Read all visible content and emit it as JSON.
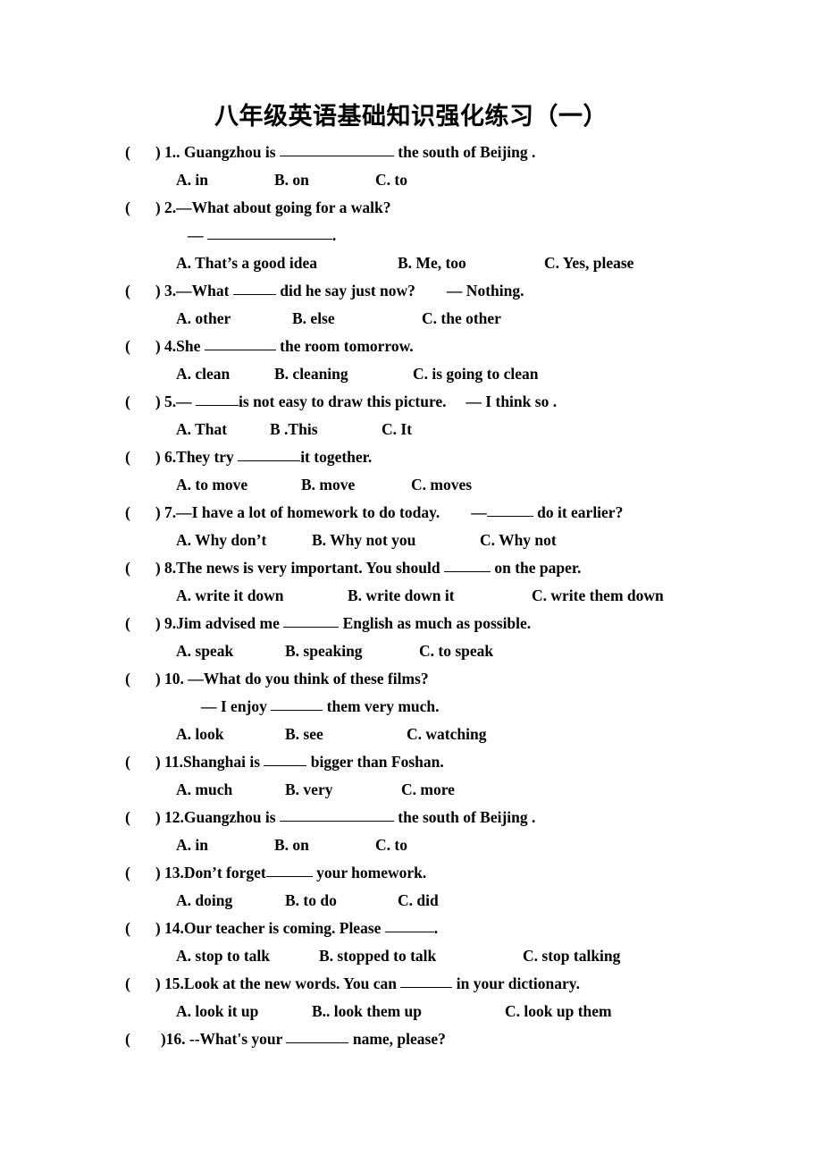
{
  "document": {
    "title": "八年级英语基础知识强化练习（一）",
    "paren_open": "(",
    "paren_close": ")"
  },
  "questions": [
    {
      "number": "1.",
      "stem_pre": ". Guangzhou is ",
      "blank_width": 128,
      "stem_post": " the south of Beijing .",
      "options": [
        {
          "label": "A. in",
          "offset": 0
        },
        {
          "label": "B. on",
          "offset": 110
        },
        {
          "label": "C. to",
          "offset": 223
        }
      ]
    },
    {
      "number": "2.",
      "stem_pre": "—What about going for a walk?",
      "blank_width": 0,
      "stem_post": "",
      "continuation": {
        "pre": "— ",
        "blank_width": 140,
        "post": "."
      },
      "options": [
        {
          "label": "A. That’s a good idea",
          "offset": 0
        },
        {
          "label": "B. Me, too",
          "offset": 248
        },
        {
          "label": "C. Yes, please",
          "offset": 412
        }
      ]
    },
    {
      "number": "3.",
      "stem_pre": "—What ",
      "blank_width": 48,
      "stem_post": " did he say just now?        — Nothing.",
      "options": [
        {
          "label": "A. other",
          "offset": 0
        },
        {
          "label": "B. else",
          "offset": 130
        },
        {
          "label": "C. the other",
          "offset": 275
        }
      ]
    },
    {
      "number": "4.",
      "stem_pre": "She ",
      "blank_width": 80,
      "stem_post": " the room tomorrow.",
      "options": [
        {
          "label": "A. clean",
          "offset": 0
        },
        {
          "label": "B. cleaning",
          "offset": 110
        },
        {
          "label": "C. is going to clean",
          "offset": 265
        }
      ]
    },
    {
      "number": "5.",
      "stem_pre": "— ",
      "blank_width": 48,
      "stem_post": "is not easy to draw this picture.     — I think so .",
      "options": [
        {
          "label": "A. That",
          "offset": 0
        },
        {
          "label": "B .This",
          "offset": 105
        },
        {
          "label": "C. It",
          "offset": 230
        }
      ]
    },
    {
      "number": "6.",
      "stem_pre": "They try ",
      "blank_width": 70,
      "stem_post": "it together.",
      "options": [
        {
          "label": "A. to move",
          "offset": 0
        },
        {
          "label": "B. move",
          "offset": 140
        },
        {
          "label": "C. moves",
          "offset": 263
        }
      ]
    },
    {
      "number": "7.",
      "stem_pre": "—I have a lot of homework to do today.        —",
      "blank_width": 52,
      "stem_post": " do it earlier?",
      "options": [
        {
          "label": "A. Why don’t",
          "offset": 0
        },
        {
          "label": "B. Why not you",
          "offset": 152
        },
        {
          "label": "C. Why not",
          "offset": 340
        }
      ]
    },
    {
      "number": "8.",
      "stem_pre": "The news is very important. You should ",
      "blank_width": 52,
      "stem_post": " on the paper.",
      "options": [
        {
          "label": "A. write it down",
          "offset": 0
        },
        {
          "label": "B. write down it",
          "offset": 192
        },
        {
          "label": "C. write them down",
          "offset": 398
        }
      ]
    },
    {
      "number": "9.",
      "stem_pre": "Jim advised me ",
      "blank_width": 62,
      "stem_post": " English as much as possible.",
      "options": [
        {
          "label": "A. speak",
          "offset": 0
        },
        {
          "label": "B. speaking",
          "offset": 122
        },
        {
          "label": "C. to speak",
          "offset": 272
        }
      ]
    },
    {
      "number": "10.",
      "stem_pre": " —What do you think of these films?",
      "blank_width": 0,
      "stem_post": "",
      "continuation": {
        "pre": "— I enjoy ",
        "blank_width": 58,
        "post": " them very much.",
        "deep": true
      },
      "options": [
        {
          "label": "A. look",
          "offset": 0
        },
        {
          "label": "B. see",
          "offset": 122
        },
        {
          "label": "C. watching",
          "offset": 258
        }
      ]
    },
    {
      "number": "11.",
      "stem_pre": "Shanghai is ",
      "blank_width": 48,
      "stem_post": " bigger than Foshan.",
      "options": [
        {
          "label": "A. much",
          "offset": 0
        },
        {
          "label": "B. very",
          "offset": 122
        },
        {
          "label": "C. more",
          "offset": 252
        }
      ]
    },
    {
      "number": "12.",
      "stem_pre": "Guangzhou is ",
      "blank_width": 128,
      "stem_post": " the south of Beijing .",
      "options": [
        {
          "label": "A. in",
          "offset": 0
        },
        {
          "label": "B. on",
          "offset": 110
        },
        {
          "label": "C. to",
          "offset": 223
        }
      ]
    },
    {
      "number": "13.",
      "stem_pre": "Don’t forget",
      "blank_width": 52,
      "stem_post": " your homework.",
      "options": [
        {
          "label": "A. doing",
          "offset": 0
        },
        {
          "label": "B. to do",
          "offset": 122
        },
        {
          "label": "C. did",
          "offset": 248
        }
      ]
    },
    {
      "number": "14.",
      "stem_pre": "Our teacher is coming. Please ",
      "blank_width": 55,
      "stem_post": ".",
      "options": [
        {
          "label": "A. stop to talk",
          "offset": 0
        },
        {
          "label": "B. stopped to talk",
          "offset": 160
        },
        {
          "label": "C. stop talking",
          "offset": 388
        }
      ]
    },
    {
      "number": "15.",
      "stem_pre": "Look at the new words. You can ",
      "blank_width": 58,
      "stem_post": " in your dictionary.",
      "options": [
        {
          "label": "A. look it up",
          "offset": 0
        },
        {
          "label": "B.. look them up",
          "offset": 152
        },
        {
          "label": "C. look up them",
          "offset": 368
        }
      ]
    },
    {
      "number": "16.",
      "number_tight": true,
      "stem_pre": " --What's your ",
      "blank_width": 70,
      "stem_post": " name, please?",
      "options": []
    }
  ]
}
